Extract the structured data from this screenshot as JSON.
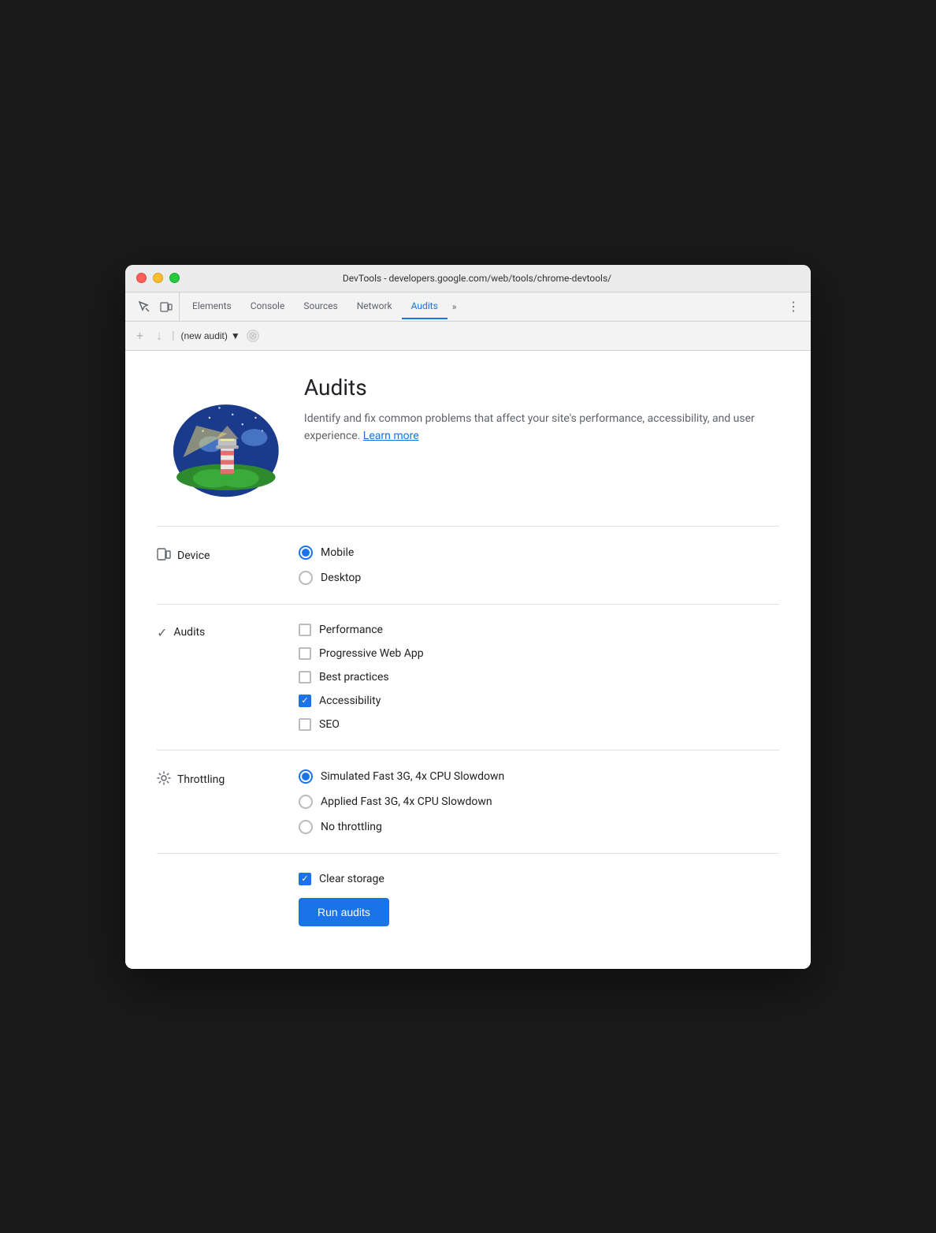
{
  "window": {
    "title": "DevTools - developers.google.com/web/tools/chrome-devtools/"
  },
  "tabs": [
    {
      "label": "Elements",
      "active": false
    },
    {
      "label": "Console",
      "active": false
    },
    {
      "label": "Sources",
      "active": false
    },
    {
      "label": "Network",
      "active": false
    },
    {
      "label": "Audits",
      "active": true
    }
  ],
  "tabs_more": "»",
  "tabs_menu": "⋮",
  "audit_toolbar": {
    "add_label": "+",
    "download_label": "↓",
    "dropdown_label": "(new audit)",
    "stop_label": "⊘"
  },
  "hero": {
    "title": "Audits",
    "description": "Identify and fix common problems that affect your site's performance, accessibility, and user experience.",
    "learn_more": "Learn more"
  },
  "device_section": {
    "label": "Device",
    "options": [
      {
        "label": "Mobile",
        "selected": true
      },
      {
        "label": "Desktop",
        "selected": false
      }
    ]
  },
  "audits_section": {
    "label": "Audits",
    "options": [
      {
        "label": "Performance",
        "checked": false
      },
      {
        "label": "Progressive Web App",
        "checked": false
      },
      {
        "label": "Best practices",
        "checked": false
      },
      {
        "label": "Accessibility",
        "checked": true
      },
      {
        "label": "SEO",
        "checked": false
      }
    ]
  },
  "throttling_section": {
    "label": "Throttling",
    "options": [
      {
        "label": "Simulated Fast 3G, 4x CPU Slowdown",
        "selected": true
      },
      {
        "label": "Applied Fast 3G, 4x CPU Slowdown",
        "selected": false
      },
      {
        "label": "No throttling",
        "selected": false
      }
    ]
  },
  "clear_storage": {
    "label": "Clear storage",
    "checked": true
  },
  "run_button": {
    "label": "Run audits"
  }
}
